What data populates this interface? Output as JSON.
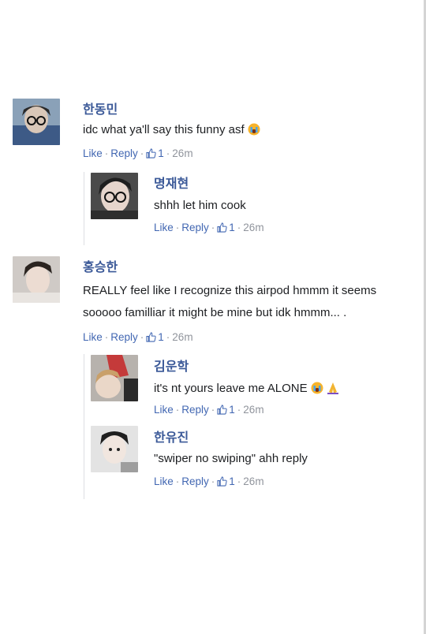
{
  "comments": [
    {
      "name": "한동민",
      "text": "idc what ya'll say this funny asf",
      "emoji": "crying-face-emoji",
      "like": "Like",
      "reply": "Reply",
      "reactions": "1",
      "time": "26m",
      "replies": [
        {
          "name": "명재현",
          "text": "shhh let him cook",
          "like": "Like",
          "reply": "Reply",
          "reactions": "1",
          "time": "26m"
        }
      ]
    },
    {
      "name": "홍승한",
      "text_line1": "REALLY feel like I recognize this airpod hmmm it seems",
      "text_line2": "sooooo familliar it might be mine but idk hmmm... .",
      "like": "Like",
      "reply": "Reply",
      "reactions": "1",
      "time": "26m",
      "replies": [
        {
          "name": "김운학",
          "text": "it's nt yours leave me ALONE",
          "emoji": [
            "crying-face-emoji",
            "pleading-hands-emoji"
          ],
          "like": "Like",
          "reply": "Reply",
          "reactions": "1",
          "time": "26m"
        },
        {
          "name": "한유진",
          "text": "\"swiper no swiping\" ahh reply",
          "like": "Like",
          "reply": "Reply",
          "reactions": "1",
          "time": "26m"
        }
      ]
    }
  ],
  "colors": {
    "name": "#3b5998",
    "link": "#4267b2",
    "muted": "#90949c"
  }
}
